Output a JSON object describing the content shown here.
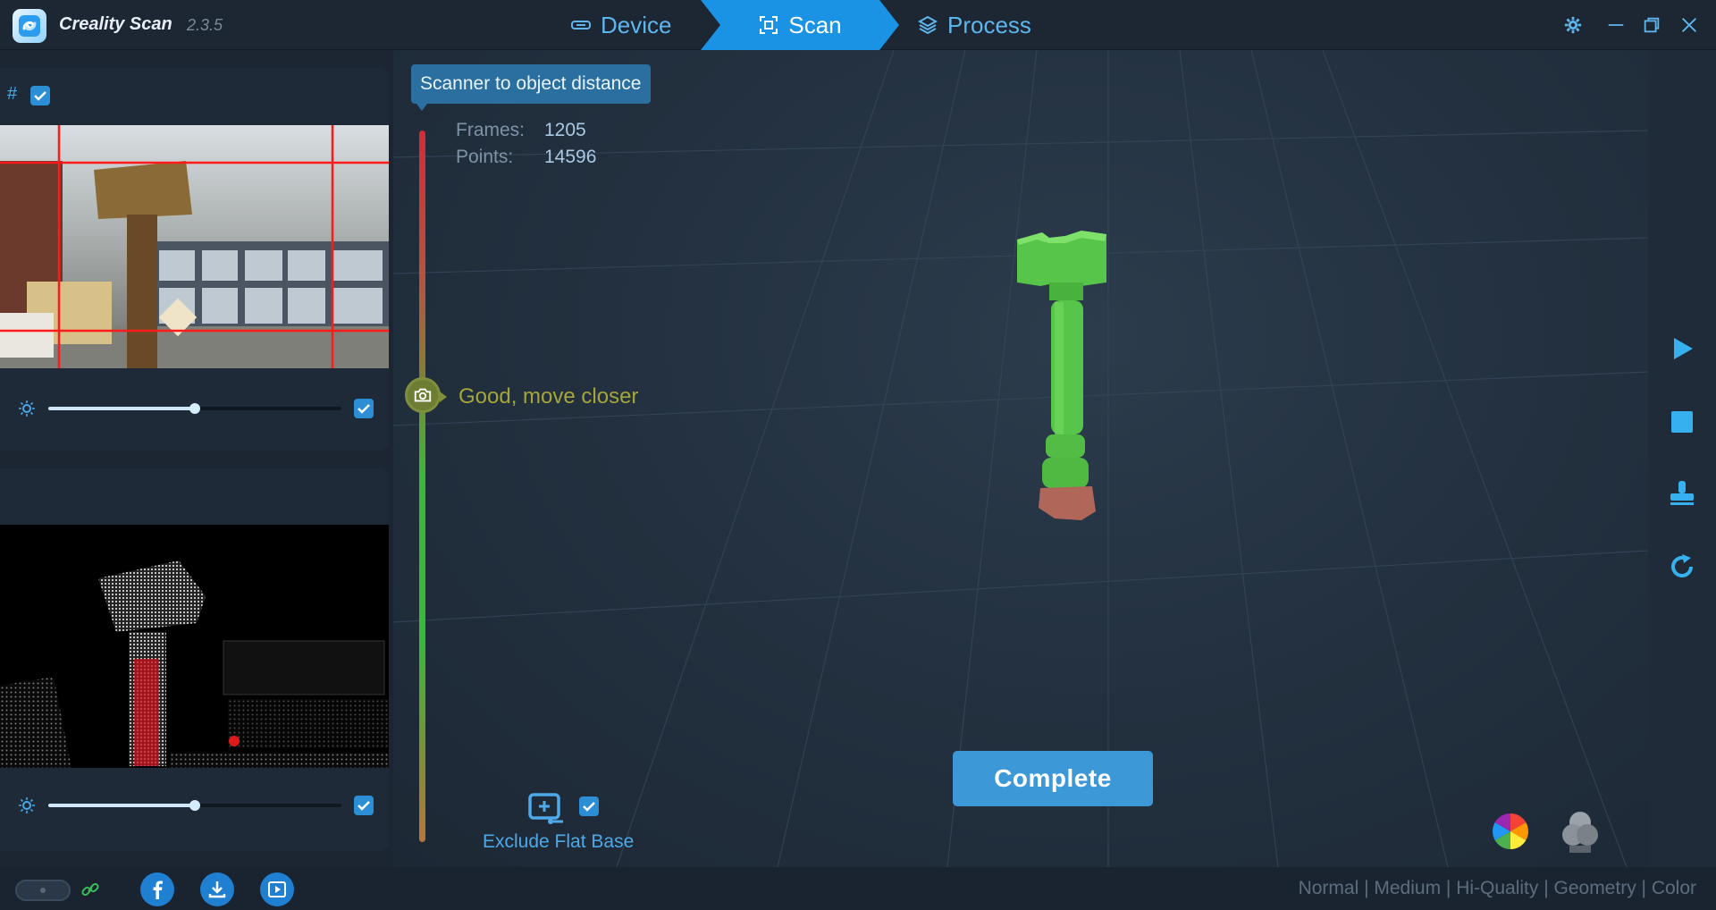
{
  "app": {
    "title": "Creality Scan",
    "version": "2.3.5"
  },
  "nav": {
    "tabs": [
      {
        "label": "Device",
        "icon": "device-icon",
        "active": false
      },
      {
        "label": "Scan",
        "icon": "scan-icon",
        "active": true
      },
      {
        "label": "Process",
        "icon": "layers-icon",
        "active": false
      }
    ]
  },
  "window_controls": [
    "gear-icon",
    "minimize-icon",
    "restore-icon",
    "close-icon"
  ],
  "rgb_camera_panel": {
    "grid_toggle_label": "#",
    "grid_enabled": true,
    "exposure_level": 0.5,
    "exposure_auto": true
  },
  "depth_camera_panel": {
    "exposure_level": 0.5,
    "exposure_auto": true
  },
  "viewport": {
    "distance_tooltip": "Scanner to object distance",
    "distance_status": "Good, move closer",
    "stats": {
      "frames_label": "Frames:",
      "frames_value": "1205",
      "points_label": "Points:",
      "points_value": "14596"
    },
    "exclude_flat_base": {
      "label": "Exclude Flat Base",
      "checked": true
    },
    "complete_button": "Complete",
    "display_modes": [
      "color-wheel-icon",
      "rgb-icon"
    ]
  },
  "right_toolbar": [
    "play-icon",
    "stop-icon",
    "stamp-icon",
    "reset-icon"
  ],
  "statusbar": {
    "social": [
      "facebook-icon",
      "download-icon",
      "video-icon"
    ],
    "quality_modes": "Normal | Medium | Hi-Quality | Geometry | Color"
  },
  "colors": {
    "accent": "#1a93e4",
    "button": "#3d98d8",
    "status_good": "#a6a53a",
    "model_green": "#57c44a"
  }
}
